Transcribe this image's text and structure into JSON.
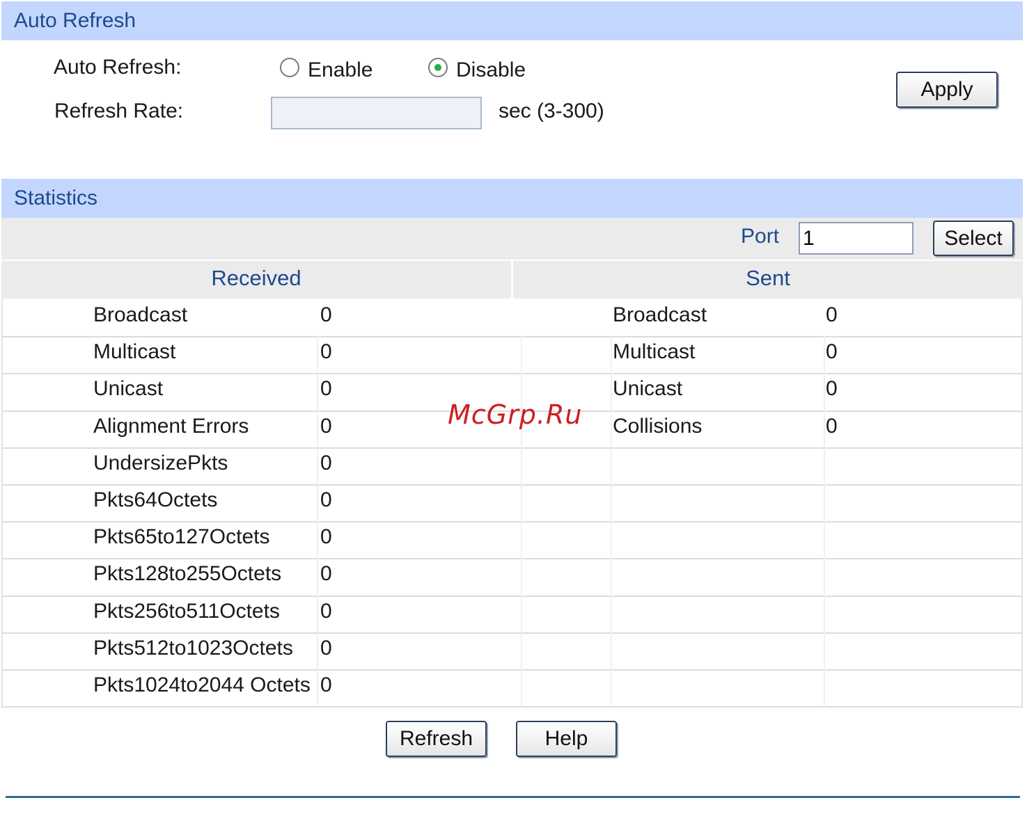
{
  "auto_refresh": {
    "header": "Auto Refresh",
    "auto_refresh_label": "Auto Refresh:",
    "enable_label": "Enable",
    "disable_label": "Disable",
    "selected": "Disable",
    "refresh_rate_label": "Refresh Rate:",
    "refresh_rate_value": "",
    "refresh_rate_unit": "sec (3-300)",
    "apply_label": "Apply"
  },
  "statistics": {
    "header": "Statistics",
    "port_label": "Port",
    "port_value": "1",
    "select_label": "Select",
    "received_header": "Received",
    "sent_header": "Sent",
    "received": [
      {
        "name": "Broadcast",
        "value": "0"
      },
      {
        "name": "Multicast",
        "value": "0"
      },
      {
        "name": "Unicast",
        "value": "0"
      },
      {
        "name": "Alignment Errors",
        "value": "0"
      },
      {
        "name": "UndersizePkts",
        "value": "0"
      },
      {
        "name": "Pkts64Octets",
        "value": "0"
      },
      {
        "name": "Pkts65to127Octets",
        "value": "0"
      },
      {
        "name": "Pkts128to255Octets",
        "value": "0"
      },
      {
        "name": "Pkts256to511Octets",
        "value": "0"
      },
      {
        "name": "Pkts512to1023Octets",
        "value": "0"
      },
      {
        "name": "Pkts1024to2044 Octets",
        "value": "0"
      }
    ],
    "sent": [
      {
        "name": "Broadcast",
        "value": "0"
      },
      {
        "name": "Multicast",
        "value": "0"
      },
      {
        "name": "Unicast",
        "value": "0"
      },
      {
        "name": "Collisions",
        "value": "0"
      }
    ]
  },
  "footer": {
    "refresh_label": "Refresh",
    "help_label": "Help"
  },
  "watermark": "McGrp.Ru",
  "colors": {
    "header_bg": "#c3d6ff",
    "header_text": "#1d4a8e",
    "band_bg": "#ebebeb",
    "radio_selected": "#2fa84f",
    "bottom_rule": "#2c6d99",
    "watermark": "#cc1f1f"
  }
}
